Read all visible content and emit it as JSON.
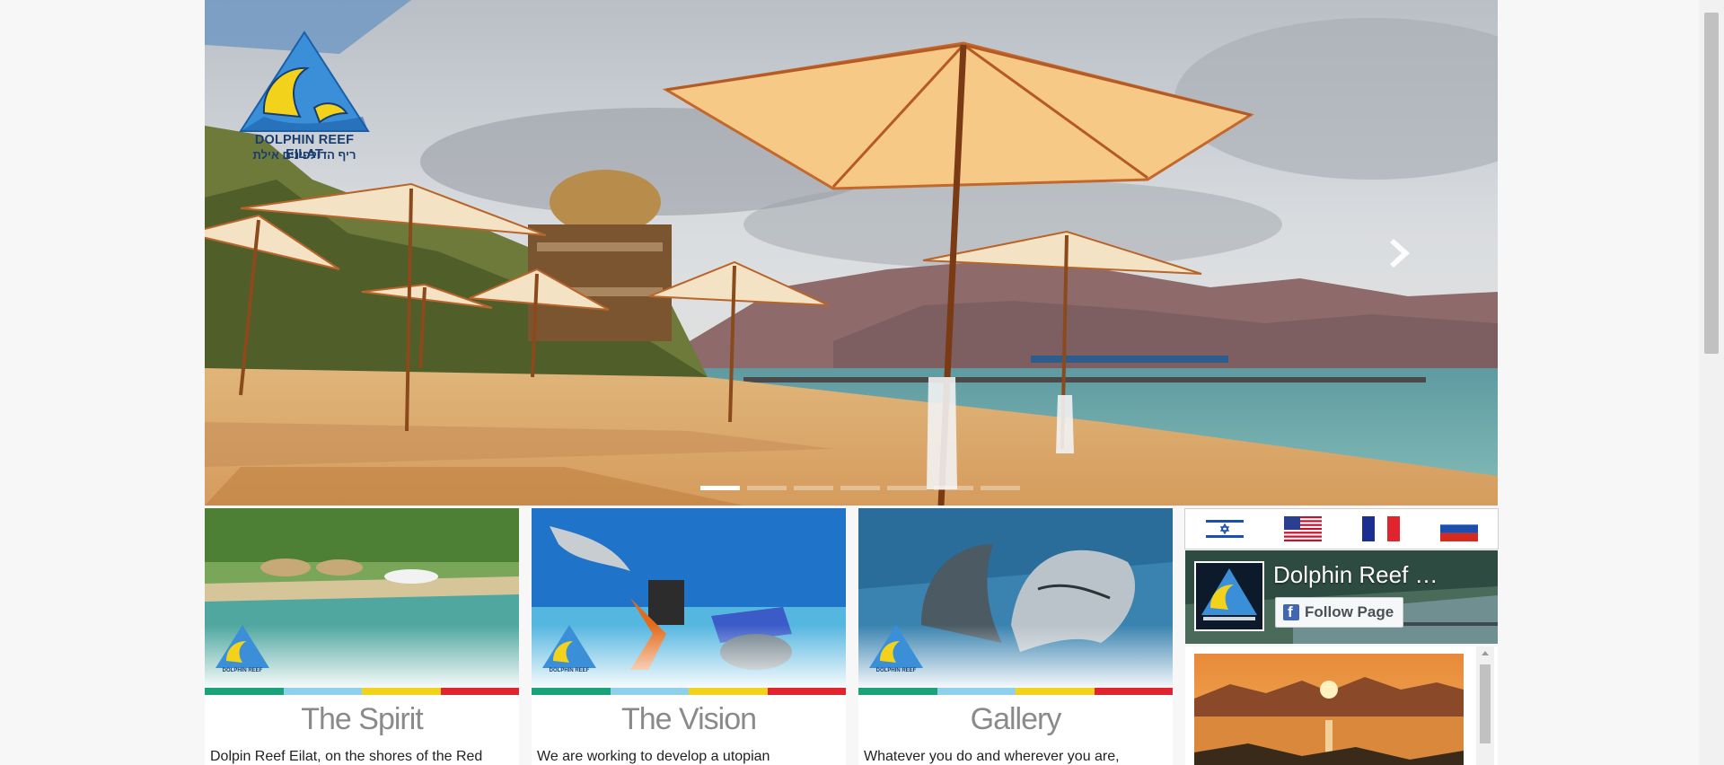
{
  "hero": {
    "logo_text_en": "DOLPHIN REEF EILAT",
    "logo_text_he": "ריף הדולפינים אילת",
    "next_icon": "chevron-right-icon",
    "indicator_count": 8,
    "active_indicator": 1
  },
  "cards": [
    {
      "title": "The Spirit",
      "desc": "Dolpin Reef Eilat, on the shores of the Red"
    },
    {
      "title": "The Vision",
      "desc": "We are working to develop a utopian"
    },
    {
      "title": "Gallery",
      "desc": "Whatever you do and wherever you are,"
    }
  ],
  "stripe_colors": [
    "#1aa37a",
    "#8fd0ec",
    "#f2d21a",
    "#e2242f"
  ],
  "languages": [
    {
      "name": "Hebrew",
      "icon": "israel-flag-icon"
    },
    {
      "name": "English",
      "icon": "usa-flag-icon"
    },
    {
      "name": "French",
      "icon": "france-flag-icon"
    },
    {
      "name": "Russian",
      "icon": "russia-flag-icon"
    }
  ],
  "facebook": {
    "page_name": "Dolphin Reef …",
    "follow_label": "Follow Page",
    "brand_color": "#4267b2"
  }
}
